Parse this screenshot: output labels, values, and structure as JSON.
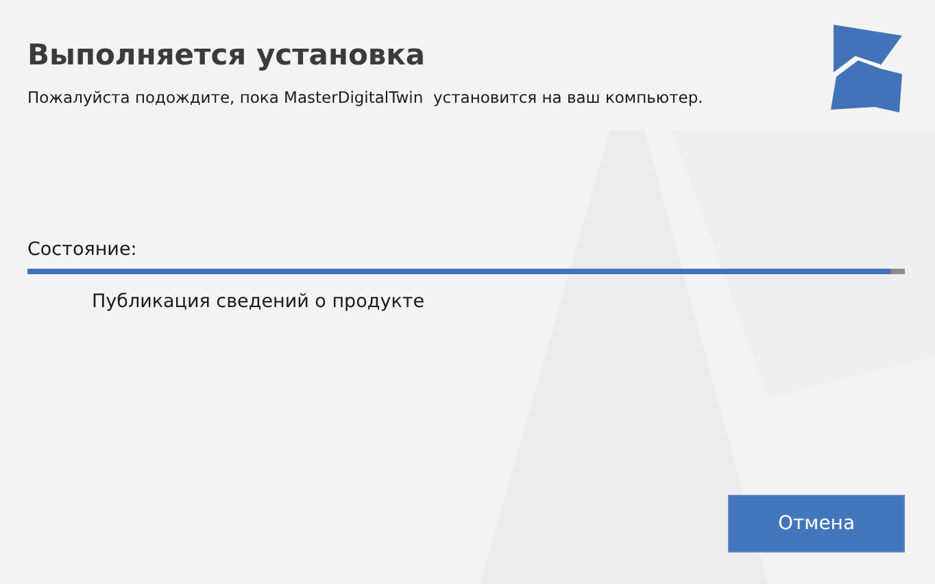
{
  "title": "Выполняется установка",
  "subtitle": "Пожалуйста подождите, пока MasterDigitalTwin  установится на ваш компьютер.",
  "status": {
    "label": "Состояние:",
    "level": 0.985,
    "detail": "Публикация сведений о продукте"
  },
  "buttons": [
    "Отмена"
  ]
}
